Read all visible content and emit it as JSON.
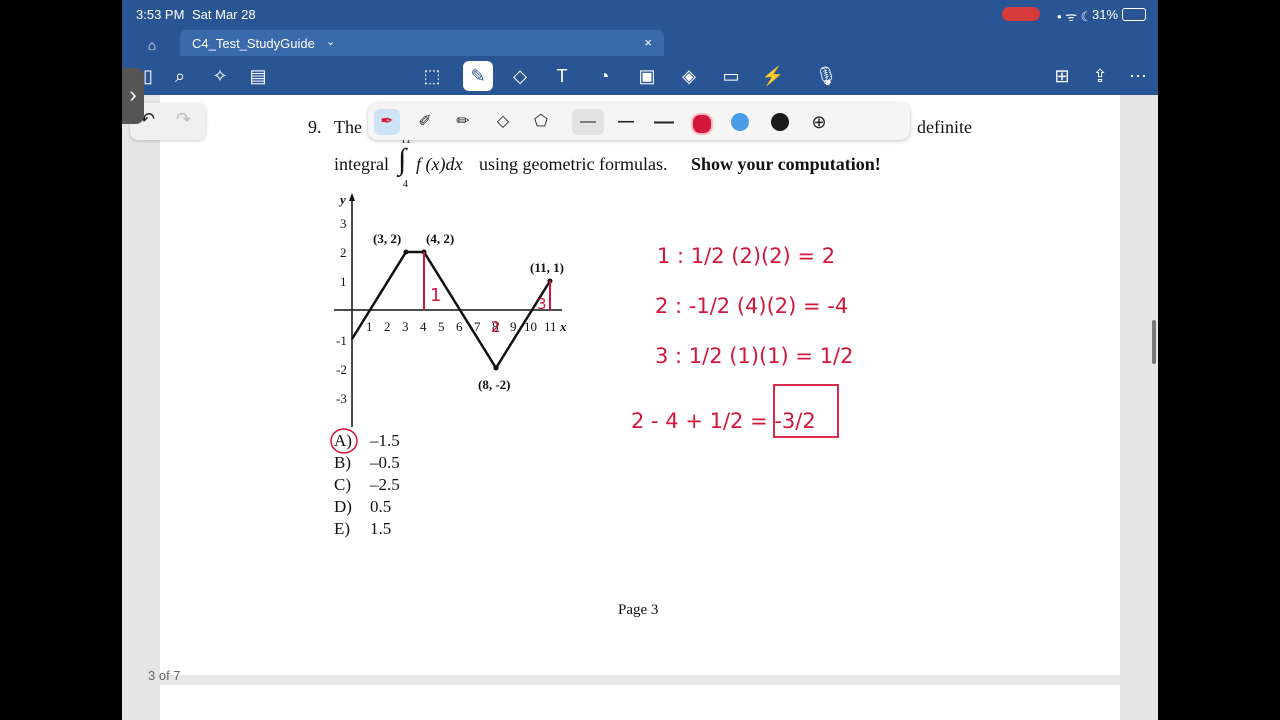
{
  "status": {
    "time": "3:53 PM",
    "date": "Sat Mar 28",
    "battery": "31%"
  },
  "tab": {
    "title": "C4_Test_StudyGuide"
  },
  "question": {
    "number": "9.",
    "line1_start": "The",
    "line1_end": "definite",
    "line2_start": "integral",
    "integral_upper": "11",
    "integral_lower": "4",
    "integrand": "f (x)dx",
    "line2_mid": "using geometric formulas.",
    "line2_bold": "Show your computation!"
  },
  "graph": {
    "y_label": "y",
    "x_label": "x",
    "x_ticks": [
      "1",
      "2",
      "3",
      "4",
      "5",
      "6",
      "7",
      "8",
      "9",
      "10",
      "11"
    ],
    "y_ticks": [
      "3",
      "2",
      "1",
      "-1",
      "-2",
      "-3"
    ],
    "points": [
      {
        "label": "(3, 2)"
      },
      {
        "label": "(4, 2)"
      },
      {
        "label": "(11, 1)"
      },
      {
        "label": "(8, -2)"
      }
    ]
  },
  "choices": [
    {
      "letter": "A)",
      "value": "–1.5"
    },
    {
      "letter": "B)",
      "value": "–0.5"
    },
    {
      "letter": "C)",
      "value": "–2.5"
    },
    {
      "letter": "D)",
      "value": "0.5"
    },
    {
      "letter": "E)",
      "value": "1.5"
    }
  ],
  "handwriting": {
    "line1": "1 : 1/2 (2)(2) = 2",
    "line2": "2 : -1/2 (4)(2) = -4",
    "line3": "3 : 1/2 (1)(1) = 1/2",
    "line4": "2 - 4 + 1/2 = -3/2",
    "region1": "1",
    "region2": "2",
    "region3": "3"
  },
  "page_footer": "Page 3",
  "page_indicator": "3 of 7",
  "colors": {
    "toolbar_blue": "#2a5595",
    "ink_red": "#d4163a",
    "pen_blue": "#4a9be8",
    "pen_black": "#1a1a1a"
  }
}
